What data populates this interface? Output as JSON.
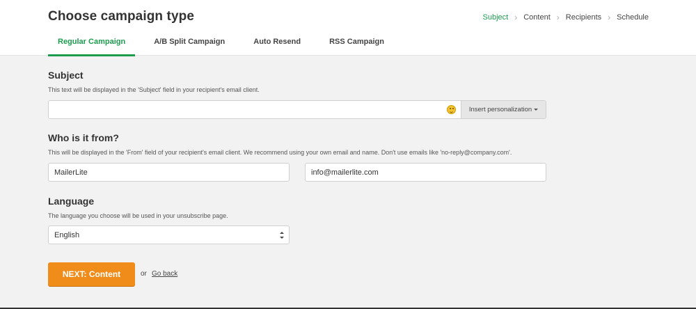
{
  "header": {
    "title": "Choose campaign type",
    "steps": [
      "Subject",
      "Content",
      "Recipients",
      "Schedule"
    ],
    "active_step": 0
  },
  "tabs": [
    {
      "label": "Regular Campaign",
      "active": true
    },
    {
      "label": "A/B Split Campaign",
      "active": false
    },
    {
      "label": "Auto Resend",
      "active": false
    },
    {
      "label": "RSS Campaign",
      "active": false
    }
  ],
  "subject": {
    "title": "Subject",
    "help": "This text will be displayed in the 'Subject' field in your recipient's email client.",
    "value": "",
    "emoji_icon": "smiley-icon",
    "personalize_label": "Insert personalization"
  },
  "from": {
    "title": "Who is it from?",
    "help": "This will be displayed in the 'From' field of your recipient's email client. We recommend using your own email and name. Don't use emails like 'no-reply@company.com'.",
    "name_value": "MailerLite",
    "email_value": "info@mailerlite.com"
  },
  "language": {
    "title": "Language",
    "help": "The language you choose will be used in your unsubscribe page.",
    "selected": "English"
  },
  "actions": {
    "next_label": "NEXT: Content",
    "or_text": "or",
    "back_label": "Go back"
  },
  "colors": {
    "accent": "#1d9b4f",
    "button": "#f08c1a"
  }
}
